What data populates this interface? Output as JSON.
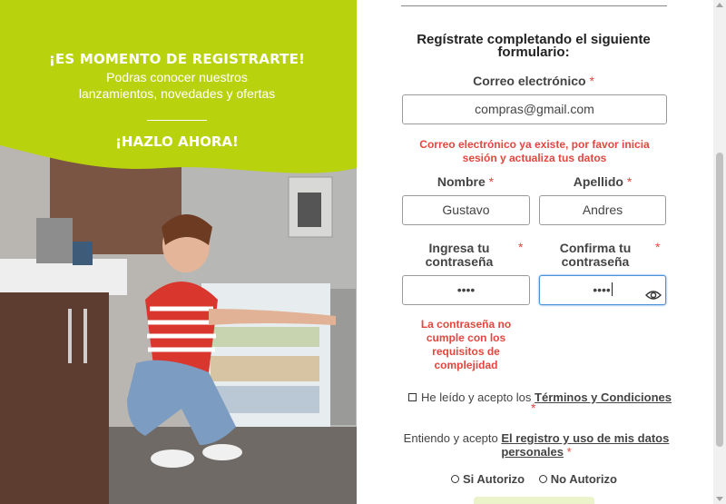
{
  "colors": {
    "brand_lime": "#b9d20e",
    "error_red": "#e2473f",
    "focus_blue": "#4a90d9"
  },
  "promo": {
    "headline": "¡ES MOMENTO DE REGISTRARTE!",
    "subtext_line1": "Podras conocer nuestros",
    "subtext_line2": "lanzamientos, novedades y ofertas",
    "cta": "¡HAZLO AHORA!"
  },
  "form": {
    "title_line1": "Regístrate completando el siguiente",
    "title_line2": "formulario:",
    "required_mark": "*",
    "email": {
      "label": "Correo electrónico",
      "value": "compras@gmail.com",
      "error_line1": "Correo electrónico ya existe, por favor inicia",
      "error_line2": "sesión y actualiza tus datos"
    },
    "first_name": {
      "label": "Nombre",
      "value": "Gustavo"
    },
    "last_name": {
      "label": "Apellido",
      "value": "Andres"
    },
    "password": {
      "label_line1": "Ingresa tu",
      "label_line2": "contraseña",
      "value": "••••",
      "error_line1": "La contraseña no",
      "error_line2": "cumple con los",
      "error_line3": "requisitos de",
      "error_line4": "complejidad"
    },
    "confirm_password": {
      "label_line1": "Confirma tu",
      "label_line2": "contraseña",
      "value": "••••",
      "toggle_icon": "eye-icon"
    },
    "terms": {
      "prefix": "He leído y acepto los",
      "link": "Términos y Condiciones"
    },
    "consent": {
      "prefix": "Entiendo y acepto",
      "link_line1": "El registro y uso de mis datos",
      "link_line2": "personales"
    },
    "radio_options": [
      "Si Autorizo",
      "No Autorizo"
    ]
  }
}
